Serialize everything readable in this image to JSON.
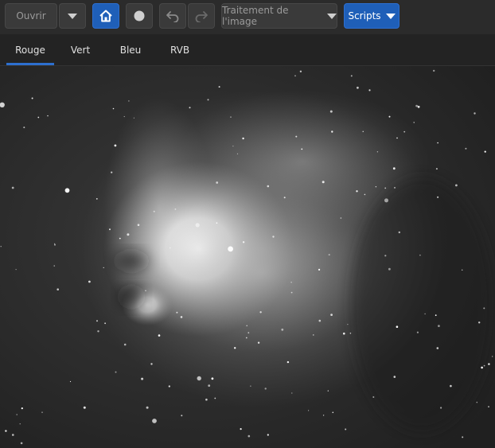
{
  "toolbar": {
    "open_label": "Ouvrir",
    "processing_label": "Traitement de l'image",
    "scripts_label": "Scripts",
    "accent_color": "#1f5fb8"
  },
  "tabs": [
    {
      "label": "Rouge",
      "active": true
    },
    {
      "label": "Vert",
      "active": false
    },
    {
      "label": "Bleu",
      "active": false
    },
    {
      "label": "RVB",
      "active": false
    }
  ],
  "viewer": {
    "image_subject": "grayscale nebula astrophotograph"
  }
}
